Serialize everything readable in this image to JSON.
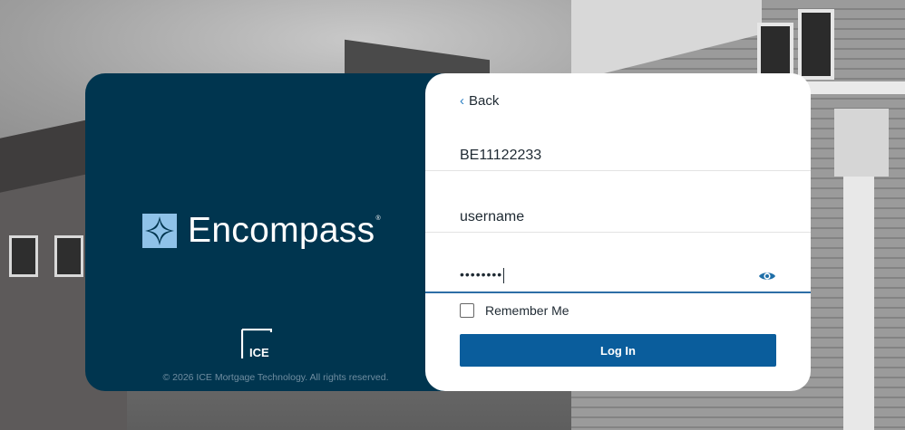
{
  "brand": {
    "name": "Encompass",
    "registered_mark": "®",
    "ice_logo_text": "ICE",
    "copyright": "© 2026 ICE Mortgage Technology. All rights reserved.",
    "colors": {
      "panel": "#00354f",
      "accent": "#2a7fc4",
      "button": "#0a5d9c"
    }
  },
  "form": {
    "back_label": "Back",
    "client_id_value": "BE11122233",
    "username_value": "username",
    "password_masked": "••••••••",
    "show_password_icon": "eye-icon",
    "remember_label": "Remember Me",
    "remember_checked": false,
    "login_label": "Log In"
  }
}
